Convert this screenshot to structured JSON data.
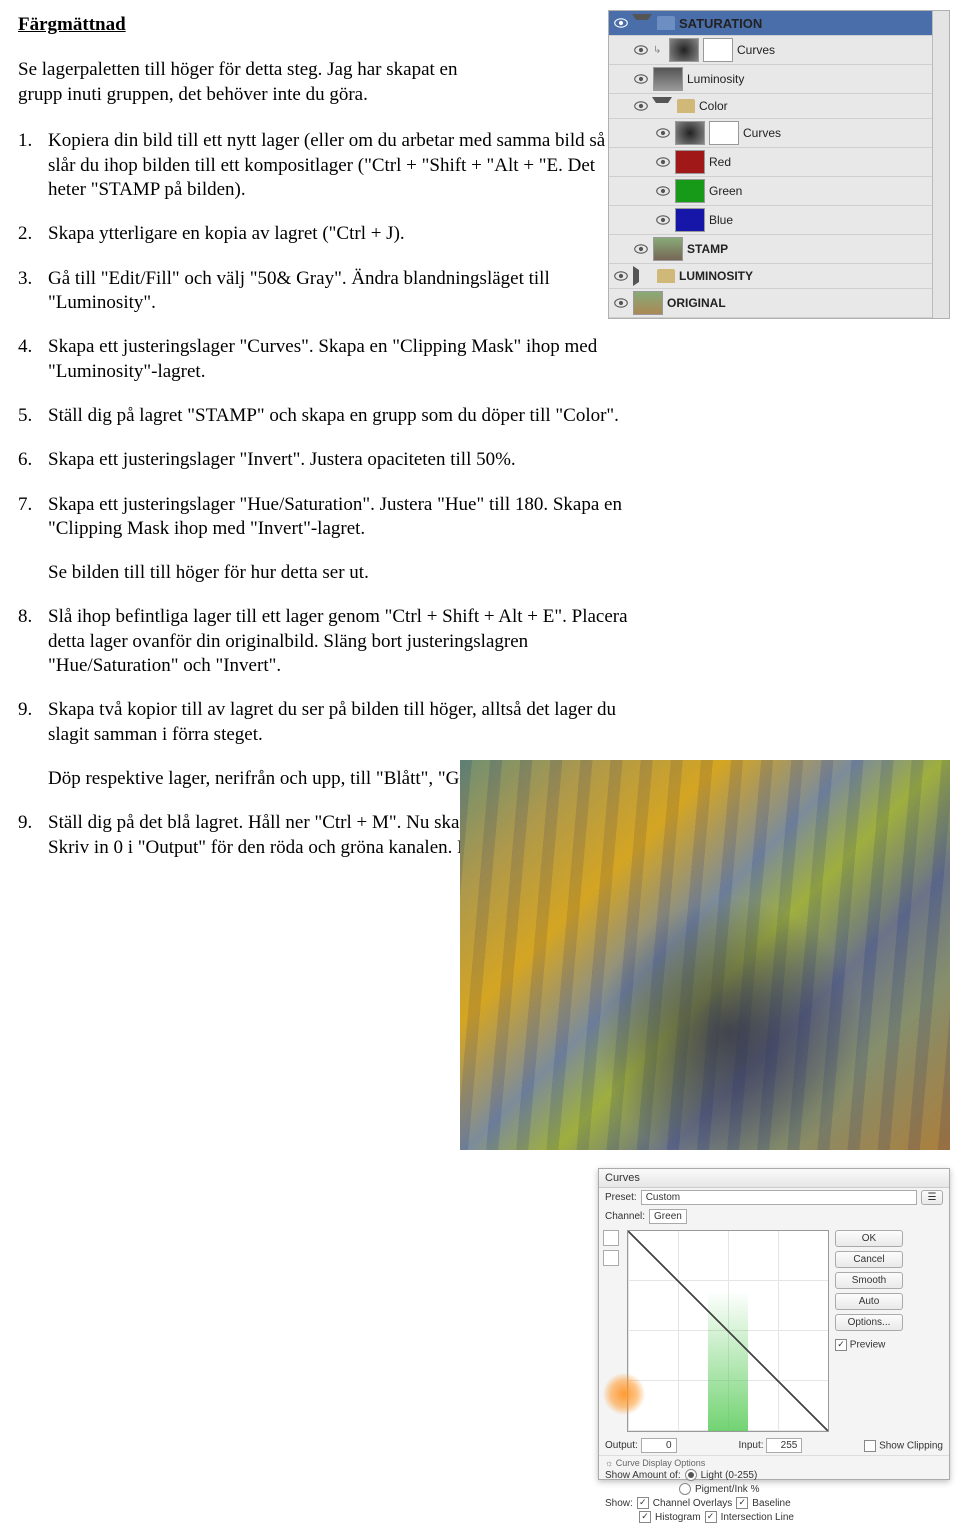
{
  "title": "Färgmättnad",
  "intro": "Se lagerpaletten till höger för detta steg. Jag har skapat en grupp inuti gruppen, det behöver inte du göra.",
  "steps": {
    "s1": {
      "num": "1.",
      "text": "Kopiera din bild till ett nytt lager (eller om du arbetar med samma bild så slår du ihop bilden till ett kompositlager (\"Ctrl + \"Shift + \"Alt + \"E. Det heter \"STAMP på bilden)."
    },
    "s2": {
      "num": "2.",
      "text": "Skapa ytterligare en kopia av lagret (\"Ctrl + J)."
    },
    "s3": {
      "num": "3.",
      "text": "Gå till \"Edit/Fill\" och välj \"50& Gray\". Ändra blandningsläget till \"Luminosity\"."
    },
    "s4": {
      "num": "4.",
      "text": "Skapa ett justeringslager \"Curves\". Skapa en \"Clipping Mask\" ihop med \"Luminosity\"-lagret."
    },
    "s5": {
      "num": "5.",
      "text": "Ställ dig på lagret \"STAMP\" och skapa en grupp som du döper till \"Color\"."
    },
    "s6": {
      "num": "6.",
      "text": "Skapa ett justeringslager \"Invert\". Justera opaciteten till 50%."
    },
    "s7": {
      "num": "7.",
      "text": "Skapa ett justeringslager \"Hue/Saturation\". Justera \"Hue\" till 180. Skapa en \"Clipping Mask ihop med  \"Invert\"-lagret."
    },
    "s7b": {
      "text": "Se bilden till till höger för hur detta ser ut."
    },
    "s8": {
      "num": "8.",
      "text": "Slå ihop befintliga lager till ett lager genom \"Ctrl + Shift + Alt + E\". Placera detta lager ovanför din originalbild. Släng bort justeringslagren \"Hue/Saturation\" och \"Invert\"."
    },
    "s9a": {
      "num": "9.",
      "text": "Skapa två kopior till av lagret du ser på bilden till höger, alltså det lager du slagit samman i förra steget."
    },
    "sDop": {
      "text": "Döp respektive lager, nerifrån och upp, till \"Blått\",  \"Grönt\" och \"Rött\"."
    },
    "s9b": {
      "num": "9.",
      "text": "Ställ dig på det blå lagret. Håll ner \"Ctrl + M\". Nu ska du få upp \"Curves\" Skriv in 0 i \"Output\" för den röda och gröna kanalen. Bilden ska nu bli blå."
    }
  },
  "layers": {
    "header": "SATURATION",
    "curves1": "Curves",
    "luminosity": "Luminosity",
    "color": "Color",
    "curves2": "Curves",
    "red": "Red",
    "green": "Green",
    "blue": "Blue",
    "stamp": "STAMP",
    "luminosity2": "LUMINOSITY",
    "original": "ORIGINAL"
  },
  "curves": {
    "title": "Curves",
    "preset_label": "Preset:",
    "preset_value": "Custom",
    "channel_label": "Channel:",
    "channel_value": "Green",
    "ok": "OK",
    "cancel": "Cancel",
    "smooth": "Smooth",
    "auto": "Auto",
    "options": "Options...",
    "preview": "Preview",
    "output_label": "Output:",
    "output_value": "0",
    "input_label": "Input:",
    "input_value": "255",
    "show_clipping": "Show Clipping",
    "curve_display": "Curve Display Options",
    "show_amount": "Show Amount of:",
    "light": "Light (0-255)",
    "pigment": "Pigment/Ink %",
    "show": "Show:",
    "overlays": "Channel Overlays",
    "baseline": "Baseline",
    "histogram": "Histogram",
    "intersection": "Intersection Line"
  }
}
